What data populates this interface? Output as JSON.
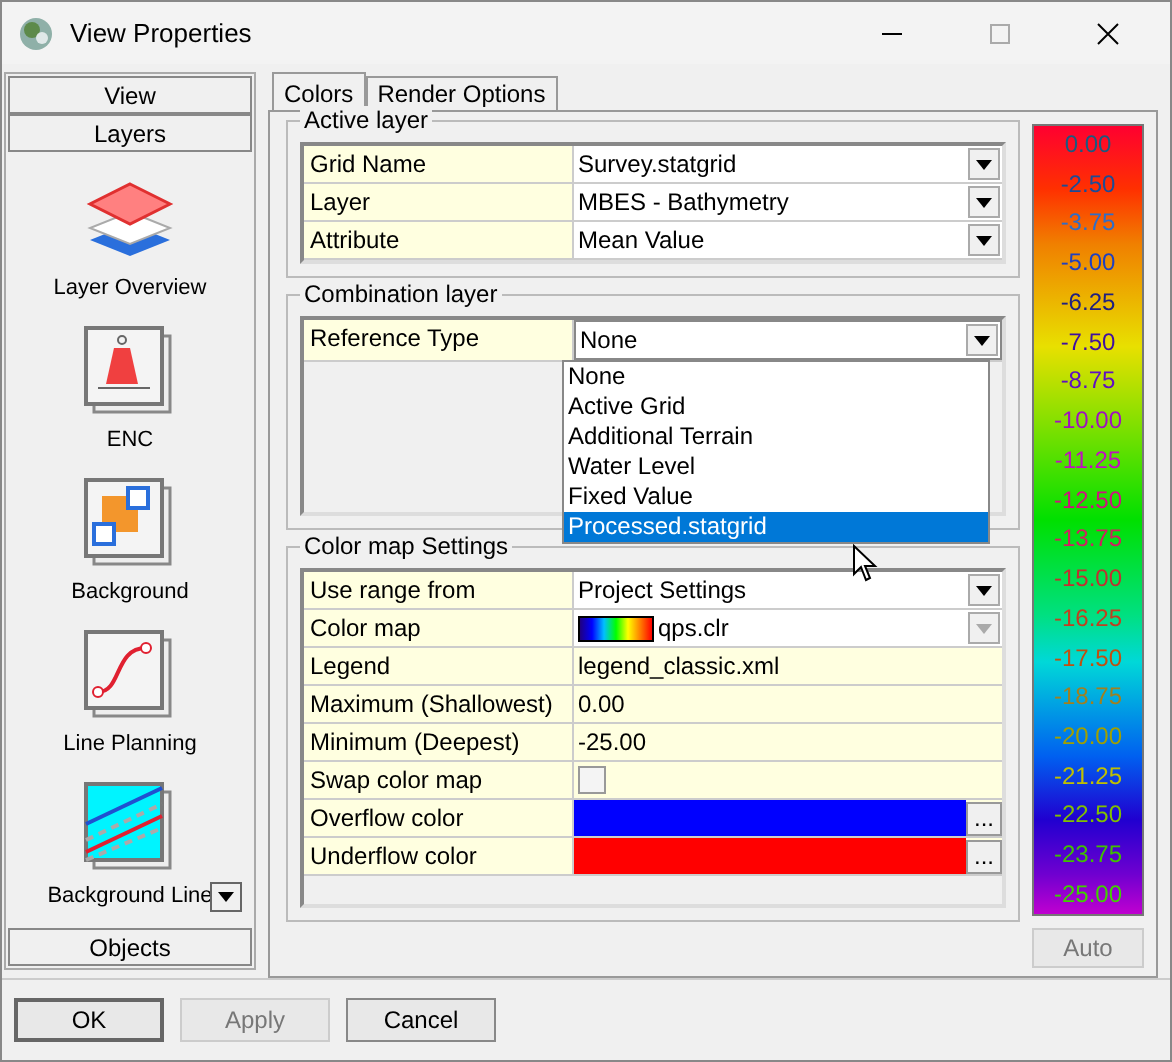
{
  "window": {
    "title": "View Properties"
  },
  "sidebar": {
    "sections": [
      {
        "label": "View"
      },
      {
        "label": "Layers"
      }
    ],
    "items": [
      {
        "label": "Layer Overview",
        "kind": "layers"
      },
      {
        "label": "ENC",
        "kind": "buoy"
      },
      {
        "label": "Background",
        "kind": "squares"
      },
      {
        "label": "Line Planning",
        "kind": "route"
      },
      {
        "label": "Background Line",
        "kind": "lines"
      }
    ],
    "footer_section": {
      "label": "Objects"
    }
  },
  "tabs": [
    {
      "label": "Colors",
      "selected": true
    },
    {
      "label": "Render Options",
      "selected": false
    }
  ],
  "active_layer": {
    "title": "Active layer",
    "rows": [
      {
        "label": "Grid Name",
        "value": "Survey.statgrid",
        "kind": "dropdown"
      },
      {
        "label": "Layer",
        "value": "MBES - Bathymetry",
        "kind": "dropdown"
      },
      {
        "label": "Attribute",
        "value": "Mean Value",
        "kind": "dropdown"
      }
    ]
  },
  "combination_layer": {
    "title": "Combination layer",
    "rows": [
      {
        "label": "Reference Type",
        "value": "None",
        "kind": "dropdown"
      }
    ],
    "dropdown_options": [
      {
        "label": "None",
        "selected": false
      },
      {
        "label": "Active Grid",
        "selected": false
      },
      {
        "label": "Additional Terrain",
        "selected": false
      },
      {
        "label": "Water Level",
        "selected": false
      },
      {
        "label": "Fixed Value",
        "selected": false
      },
      {
        "label": "Processed.statgrid",
        "selected": true
      }
    ]
  },
  "color_map_settings": {
    "title": "Color map Settings",
    "rows": [
      {
        "label": "Use range from",
        "value": "Project Settings",
        "kind": "dropdown"
      },
      {
        "label": "Color map",
        "value": "qps.clr",
        "kind": "colormap",
        "disabled": true
      },
      {
        "label": "Legend",
        "value": "legend_classic.xml",
        "kind": "text"
      },
      {
        "label": "Maximum (Shallowest)",
        "value": "0.00",
        "kind": "text"
      },
      {
        "label": "Minimum (Deepest)",
        "value": "-25.00",
        "kind": "text"
      },
      {
        "label": "Swap color map",
        "kind": "checkbox",
        "checked": false
      },
      {
        "label": "Overflow color",
        "kind": "color",
        "color": "#0000ff",
        "button": "..."
      },
      {
        "label": "Underflow color",
        "kind": "color",
        "color": "#ff0000",
        "button": "..."
      }
    ]
  },
  "legend": {
    "labels": [
      {
        "text": "0.00",
        "color": "#1a5a80"
      },
      {
        "text": "-2.50",
        "color": "#1a4c98"
      },
      {
        "text": "-3.75",
        "color": "#2e6ec8"
      },
      {
        "text": "-5.00",
        "color": "#2040c0"
      },
      {
        "text": "-6.25",
        "color": "#202080"
      },
      {
        "text": "-7.50",
        "color": "#4010a0"
      },
      {
        "text": "-8.75",
        "color": "#6010c0"
      },
      {
        "text": "-10.00",
        "color": "#a010c0"
      },
      {
        "text": "-11.25",
        "color": "#c010c0"
      },
      {
        "text": "-12.50",
        "color": "#d01080"
      },
      {
        "text": "-13.75",
        "color": "#d02060"
      },
      {
        "text": "-15.00",
        "color": "#c03030"
      },
      {
        "text": "-16.25",
        "color": "#c04020"
      },
      {
        "text": "-17.50",
        "color": "#c05010"
      },
      {
        "text": "-18.75",
        "color": "#a08020"
      },
      {
        "text": "-20.00",
        "color": "#a0a000"
      },
      {
        "text": "-21.25",
        "color": "#c0c000"
      },
      {
        "text": "-22.50",
        "color": "#80c000"
      },
      {
        "text": "-23.75",
        "color": "#40c000"
      },
      {
        "text": "-25.00",
        "color": "#40d000"
      }
    ],
    "auto_button": {
      "label": "Auto",
      "disabled": true
    }
  },
  "buttons": [
    {
      "label": "OK",
      "disabled": false
    },
    {
      "label": "Apply",
      "disabled": true
    },
    {
      "label": "Cancel",
      "disabled": false
    }
  ]
}
